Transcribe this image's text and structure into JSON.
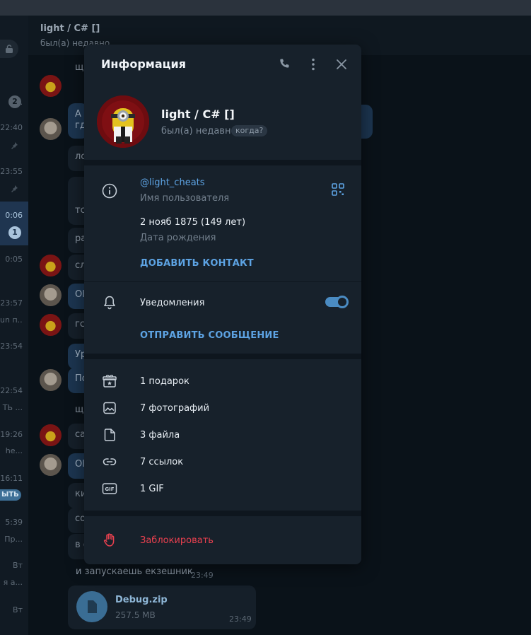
{
  "chat": {
    "title": "light / C# []",
    "status": "был(а) недавно"
  },
  "left_list": {
    "badge_top": "2",
    "badge_active": "1",
    "times": [
      "22:40",
      "23:55",
      "0:06",
      "0:05",
      "23:57",
      "23:54",
      "22:54",
      "19:26",
      "16:11",
      "5:39",
      "Вт",
      "Вт"
    ],
    "snippets": [
      "un п...",
      "ТЬ ...",
      "he...",
      "Пр...",
      "я а..."
    ],
    "pill_label": "ЫТЬ"
  },
  "messages": {
    "snippets": [
      "щ",
      "А",
      "гд",
      "лс",
      "тс",
      "ра",
      "сл",
      "Ol",
      "гс",
      "Ур",
      "По",
      "щ",
      "са",
      "Ol",
      "ки",
      "со",
      "в с"
    ],
    "last_text": "и запускаешь екзешник",
    "last_time": "23:49",
    "file_name": "Debug.zip",
    "file_size": "257.5 MB",
    "file_time": "23:49"
  },
  "panel": {
    "title": "Информация",
    "name": "light / C# []",
    "status": "был(а) недавно",
    "when_label": "когда?",
    "username": "@light_cheats",
    "username_label": "Имя пользователя",
    "birthday": "2 нояб 1875 (149 лет)",
    "birthday_label": "Дата рождения",
    "add_contact": "ДОБАВИТЬ КОНТАКТ",
    "notifications_label": "Уведомления",
    "notifications_on": true,
    "send_message": "ОТПРАВИТЬ СООБЩЕНИЕ",
    "media": [
      {
        "icon": "gift-icon",
        "label": "1 подарок"
      },
      {
        "icon": "photo-icon",
        "label": "7 фотографий"
      },
      {
        "icon": "file-icon",
        "label": "3 файла"
      },
      {
        "icon": "link-icon",
        "label": "7 ссылок"
      },
      {
        "icon": "gif-icon",
        "label": "1 GIF"
      }
    ],
    "block": "Заблокировать"
  },
  "colors": {
    "accent": "#5da3e3",
    "danger": "#e8404f",
    "panel_bg": "#17212b",
    "toggle": "#4a8bc2"
  }
}
